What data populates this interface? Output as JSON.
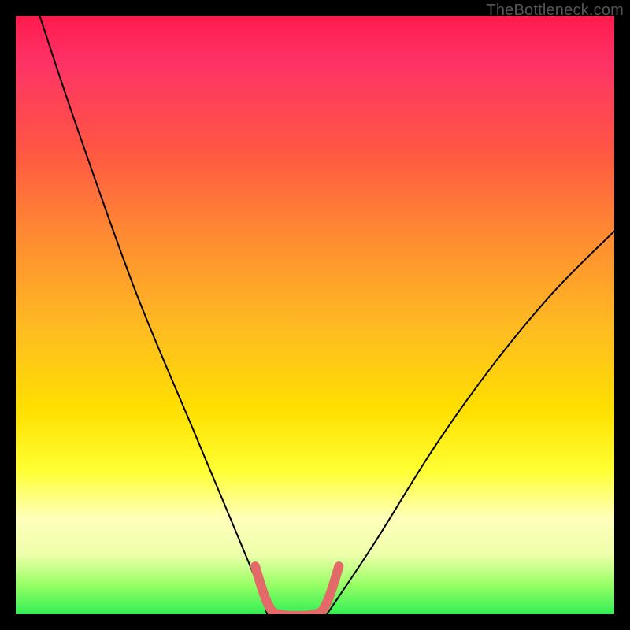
{
  "watermark": "TheBottleneck.com",
  "chart_data": {
    "type": "line",
    "title": "",
    "xlabel": "",
    "ylabel": "",
    "xlim": [
      0,
      100
    ],
    "ylim": [
      0,
      100
    ],
    "series": [
      {
        "name": "curve-left",
        "x": [
          4,
          10,
          20,
          30,
          40,
          42
        ],
        "y": [
          100,
          82,
          54,
          30,
          6,
          0
        ]
      },
      {
        "name": "curve-right",
        "x": [
          52,
          60,
          70,
          80,
          90,
          100
        ],
        "y": [
          0,
          12,
          28,
          42,
          54,
          64
        ]
      },
      {
        "name": "trough-highlight",
        "x": [
          40,
          42,
          44,
          50,
          52,
          54
        ],
        "y": [
          8,
          2,
          0,
          0,
          2,
          8
        ]
      }
    ],
    "colors": {
      "curve": "#000000",
      "highlight": "#e46a6a"
    }
  }
}
